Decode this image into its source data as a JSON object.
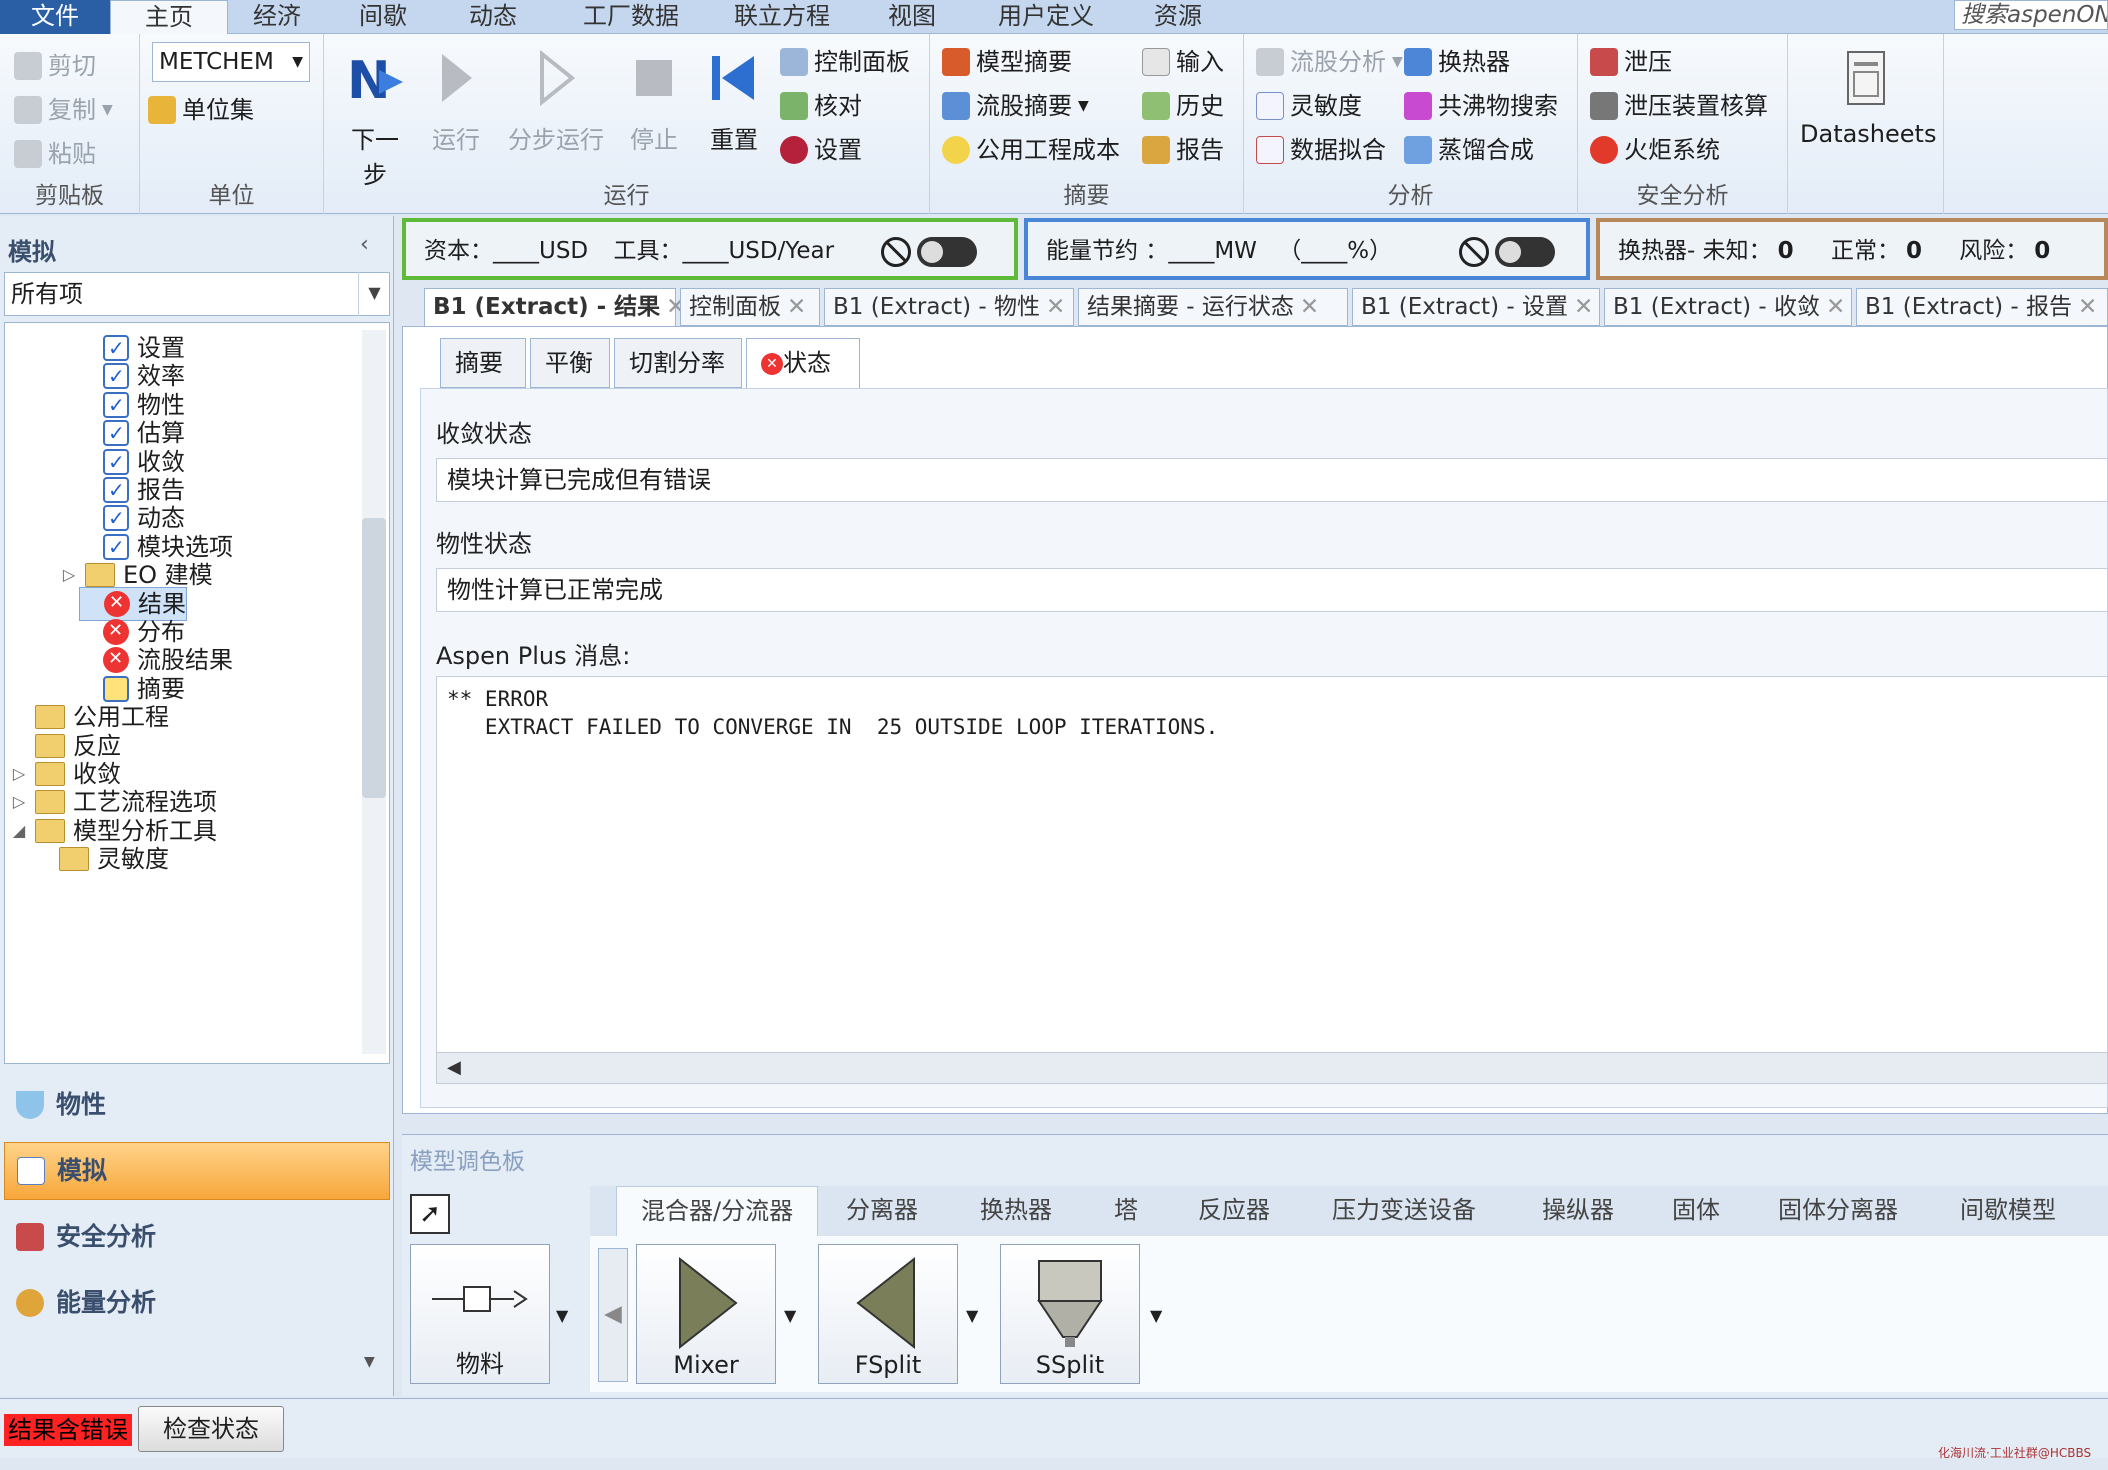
{
  "menu": {
    "file": "文件",
    "items": [
      "主页",
      "经济",
      "间歇",
      "动态",
      "工厂数据",
      "联立方程",
      "视图",
      "用户定义",
      "资源"
    ],
    "search": "搜索aspenONE"
  },
  "ribbon": {
    "clipboard": {
      "title": "剪贴板",
      "cut": "剪切",
      "copy": "复制",
      "paste": "粘贴"
    },
    "units": {
      "title": "单位",
      "unit_set_value": "METCHEM",
      "unit_sets": "单位集"
    },
    "run": {
      "title": "运行",
      "next": "下一步",
      "run": "运行",
      "step": "分步运行",
      "stop": "停止",
      "reset": "重置",
      "control_panel": "控制面板",
      "reconcile": "核对",
      "settings": "设置"
    },
    "summary": {
      "title": "摘要",
      "model_summary": "模型摘要",
      "stream_summary": "流股摘要",
      "utility_costs": "公用工程成本",
      "input": "输入",
      "history": "历史",
      "report": "报告"
    },
    "analysis": {
      "title": "分析",
      "stream_analysis": "流股分析",
      "sensitivity": "灵敏度",
      "data_fit": "数据拟合",
      "heat_exchanger": "换热器",
      "azeotrope": "共沸物搜索",
      "distillation": "蒸馏合成"
    },
    "safety": {
      "title": "安全分析",
      "relief": "泄压",
      "relief_check": "泄压装置核算",
      "flare": "火炬系统"
    },
    "datasheets": "Datasheets"
  },
  "nav": {
    "title": "模拟",
    "filter": "所有项",
    "tree": [
      {
        "label": "设置",
        "icon": "ok"
      },
      {
        "label": "效率",
        "icon": "ok"
      },
      {
        "label": "物性",
        "icon": "ok"
      },
      {
        "label": "估算",
        "icon": "ok"
      },
      {
        "label": "收敛",
        "icon": "ok"
      },
      {
        "label": "报告",
        "icon": "ok"
      },
      {
        "label": "动态",
        "icon": "ok"
      },
      {
        "label": "模块选项",
        "icon": "ok"
      },
      {
        "label": "EO 建模",
        "icon": "folder"
      },
      {
        "label": "结果",
        "icon": "error"
      },
      {
        "label": "分布",
        "icon": "error"
      },
      {
        "label": "流股结果",
        "icon": "error"
      },
      {
        "label": "摘要",
        "icon": "summary"
      },
      {
        "label": "公用工程",
        "icon": "folder"
      },
      {
        "label": "反应",
        "icon": "folder"
      },
      {
        "label": "收敛",
        "icon": "folder"
      },
      {
        "label": "工艺流程选项",
        "icon": "folder"
      },
      {
        "label": "模型分析工具",
        "icon": "folder"
      },
      {
        "label": "灵敏度",
        "icon": "folder"
      }
    ],
    "buttons": {
      "properties": "物性",
      "simulation": "模拟",
      "safety": "安全分析",
      "energy": "能量分析"
    }
  },
  "banners": {
    "capital_label": "资本：",
    "capital_value": "____USD",
    "utility_label": "工具：",
    "utility_value": "____USD/Year",
    "energy_label": "能量节约 ：",
    "energy_value": "____MW",
    "energy_pct": "（____%）",
    "hx_label": "换热器- 未知：",
    "hx_unknown": "0",
    "hx_ok_label": "正常：",
    "hx_ok": "0",
    "hx_risk_label": "风险：",
    "hx_risk": "0"
  },
  "doc_tabs": [
    "B1 (Extract) - 结果",
    "控制面板",
    "B1 (Extract) - 物性",
    "结果摘要 - 运行状态",
    "B1 (Extract) - 设置",
    "B1 (Extract) - 收敛",
    "B1 (Extract) - 报告"
  ],
  "sub_tabs": [
    "摘要",
    "平衡",
    "切割分率",
    "状态"
  ],
  "form": {
    "conv_label": "收敛状态",
    "conv_value": "模块计算已完成但有错误",
    "prop_label": "物性状态",
    "prop_value": "物性计算已正常完成",
    "msg_label": "Aspen Plus 消息:",
    "msg_line1": "** ERROR",
    "msg_line2": "   EXTRACT FAILED TO CONVERGE IN  25 OUTSIDE LOOP ITERATIONS."
  },
  "palette": {
    "title": "模型调色板",
    "tabs": [
      "混合器/分流器",
      "分离器",
      "换热器",
      "塔",
      "反应器",
      "压力变送设备",
      "操纵器",
      "固体",
      "固体分离器",
      "间歇模型"
    ],
    "items": [
      "物料",
      "Mixer",
      "FSplit",
      "SSplit"
    ]
  },
  "status": {
    "error": "结果含错误",
    "check": "检查状态"
  },
  "watermark": "化海川流·工业社群@HCBBS"
}
